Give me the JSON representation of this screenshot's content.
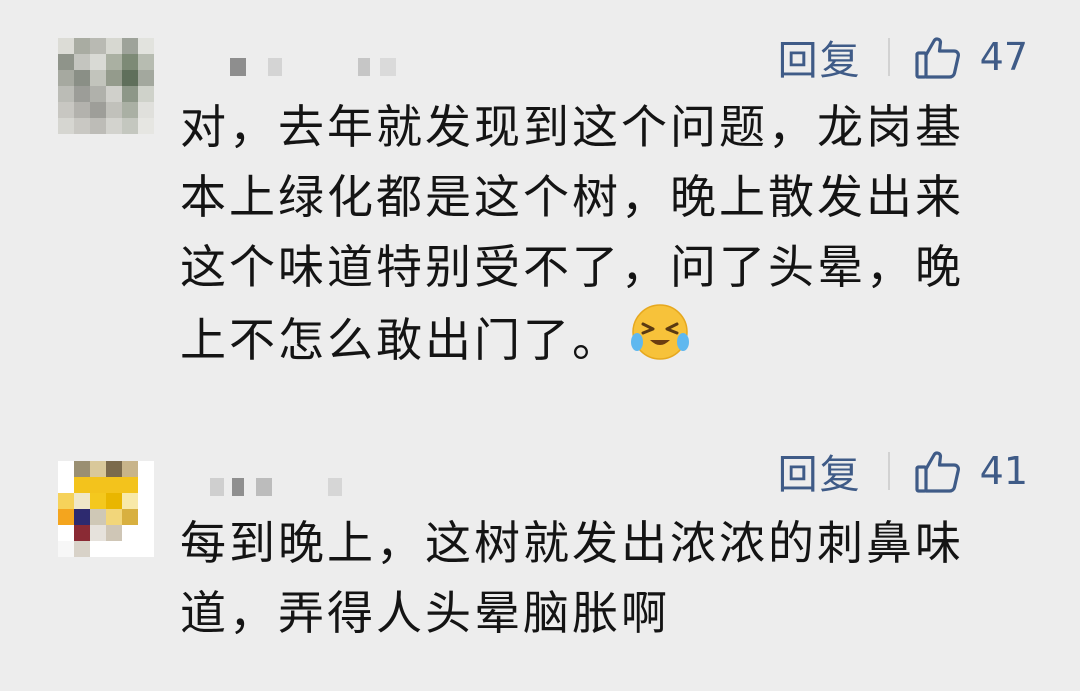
{
  "comments": [
    {
      "reply_label": "回复",
      "likes": "47",
      "text": "对，去年就发现到这个问题，龙岗基本上绿化都是这个树，晚上散发出来这个味道特别受不了，问了头晕，晚上不怎么敢出门了。",
      "emoji": "laughing-tears-emoji"
    },
    {
      "reply_label": "回复",
      "likes": "41",
      "text": "每到晚上，这树就发出浓浓的刺鼻味道，弄得人头晕脑胀啊"
    }
  ],
  "icons": {
    "like": "thumbs-up-icon"
  },
  "colors": {
    "background": "#ededed",
    "link": "#3f5b87",
    "text": "#141414"
  }
}
